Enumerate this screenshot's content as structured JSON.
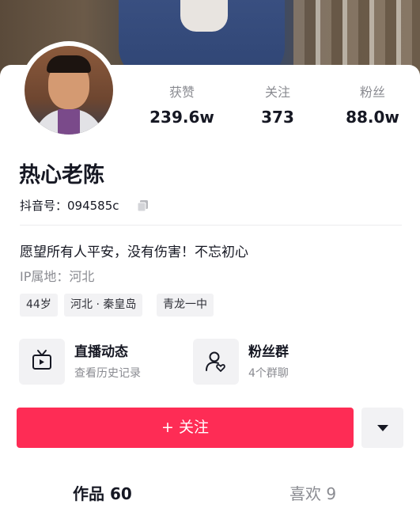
{
  "profile": {
    "name": "热心老陈",
    "id_label": "抖音号：094585c",
    "bio": "愿望所有人平安，没有伤害！不忘初心",
    "ip_location": "IP属地：河北",
    "tags": [
      "44岁",
      "河北 · 秦皇岛",
      "青龙一中"
    ]
  },
  "stats": [
    {
      "label": "获赞",
      "value": "239.6w"
    },
    {
      "label": "关注",
      "value": "373"
    },
    {
      "label": "粉丝",
      "value": "88.0w"
    }
  ],
  "features": [
    {
      "title": "直播动态",
      "subtitle": "查看历史记录",
      "icon": "tv-icon"
    },
    {
      "title": "粉丝群",
      "subtitle": "4个群聊",
      "icon": "user-heart-icon"
    }
  ],
  "actions": {
    "follow_label": "+ 关注",
    "more_icon": "caret-down-icon"
  },
  "tabs": [
    {
      "label": "作品 60",
      "active": true
    },
    {
      "label": "喜欢 9",
      "active": false
    }
  ],
  "colors": {
    "accent": "#fe2c55",
    "muted_text": "#8a8b91",
    "chip_bg": "#f2f2f4"
  }
}
